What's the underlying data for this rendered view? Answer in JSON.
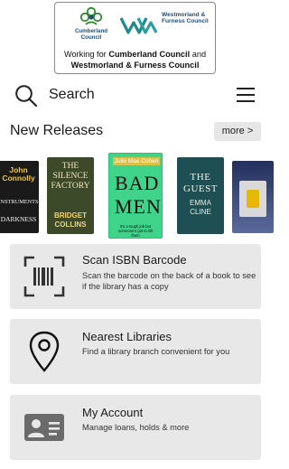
{
  "header": {
    "council_left": "Cumberland Council",
    "council_right": "Westmorland & Furness Council",
    "working_prefix": "Working for",
    "working_council_1": "Cumberland Council",
    "working_and": "and",
    "working_council_2": "Westmorland & Furness Council"
  },
  "search": {
    "label": "Search",
    "icon": "search-icon",
    "menu_icon": "hamburger-menu-icon"
  },
  "new_releases": {
    "title": "New Releases",
    "more_label": "more >",
    "books": [
      {
        "author": "John Connolly",
        "title": "THE INSTRUMENTS OF DARKNESS",
        "title_short": "INSTRUMENTS",
        "extra": "DARKNESS"
      },
      {
        "author": "BRIDGET COLLINS",
        "title": "THE SILENCE FACTORY",
        "author_short": "BRIDGET",
        "author_short2": "COLLINS"
      },
      {
        "author": "Julie Mae Cohen",
        "title": "BAD MEN",
        "tagline": "It's a tough job but someone's got to kill them"
      },
      {
        "author": "EMMA CLINE",
        "title": "THE GUEST",
        "author_short": "EMMA",
        "author_short2": "CLINE"
      },
      {
        "author": "",
        "title": ""
      }
    ]
  },
  "cards": [
    {
      "title": "Scan ISBN Barcode",
      "description": "Scan the barcode on the back of a book to see if the library has a copy",
      "icon": "barcode-scan-icon"
    },
    {
      "title": "Nearest Libraries",
      "description": "Find a library branch convenient for you",
      "icon": "map-pin-icon"
    },
    {
      "title": "My Account",
      "description": "Manage loans, holds & more",
      "icon": "id-card-icon"
    }
  ]
}
